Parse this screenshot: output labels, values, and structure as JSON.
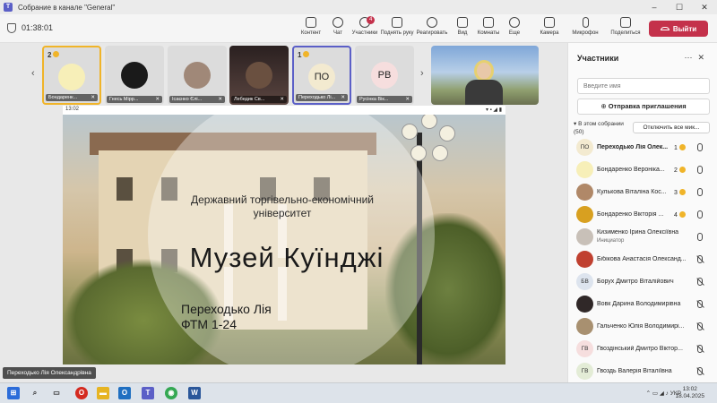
{
  "window": {
    "title": "Собрание в канале \"General\""
  },
  "toolbar": {
    "timer": "01:38:01",
    "buttons": [
      "Контент",
      "Чат",
      "Участники",
      "Поднять руку",
      "Реагировать",
      "Вид",
      "Комнаты",
      "Еще",
      "Камера",
      "Микрофон",
      "Поделиться"
    ],
    "participants_badge": "4",
    "leave_label": "Выйти"
  },
  "strip": {
    "tiles": [
      {
        "initials": "",
        "name": "Бондаренк...",
        "hand": "2"
      },
      {
        "initials": "",
        "name": "Гнесь Мірр...",
        "hand": ""
      },
      {
        "initials": "",
        "name": "Ісаєнко Єлі...",
        "hand": ""
      },
      {
        "initials": "",
        "name": "Лебедик Св...",
        "hand": ""
      },
      {
        "initials": "ПО",
        "name": "Переходько Лі...",
        "hand": "1"
      },
      {
        "initials": "РВ",
        "name": "Русінка Вік...",
        "hand": ""
      }
    ]
  },
  "slide": {
    "timestamp": "13:02",
    "university": "Державний торгівельно-економічний університет",
    "title": "Музей Куїнджі",
    "author": "Переходько Лія",
    "group": "ФТМ 1-24"
  },
  "presenter_label": "Переходько Лія Олександрівна",
  "panel": {
    "title": "Участники",
    "search_placeholder": "Введите имя",
    "invite_label": "Отправка приглашения",
    "section_label": "В этом собрании",
    "section_count": "(50)",
    "mute_all_label": "Отключить все мик...",
    "participants": [
      {
        "initials": "ПО",
        "name": "Переходько Лія Олек...",
        "hand": "1",
        "muted": false,
        "bold": true,
        "role": "",
        "color": "#f3ead0"
      },
      {
        "initials": "",
        "name": "Бондаренко Вероніка...",
        "hand": "2",
        "muted": false,
        "bold": false,
        "role": "",
        "color": "#f7efb8"
      },
      {
        "initials": "",
        "name": "Кулькова Віталіна Кос...",
        "hand": "3",
        "muted": false,
        "bold": false,
        "role": "",
        "color": "#b08868"
      },
      {
        "initials": "",
        "name": "Бондаренко Вікторія ...",
        "hand": "4",
        "muted": false,
        "bold": false,
        "role": "",
        "color": "#d8a020"
      },
      {
        "initials": "",
        "name": "Кизименко Ірина Олексіївна",
        "hand": "",
        "muted": false,
        "bold": false,
        "role": "Инициатор",
        "color": "#c8c0b8"
      },
      {
        "initials": "",
        "name": "Бібікова Анастасія Олександ...",
        "hand": "",
        "muted": true,
        "bold": false,
        "role": "",
        "color": "#c04030"
      },
      {
        "initials": "БВ",
        "name": "Борух Дмитро Віталійович",
        "hand": "",
        "muted": true,
        "bold": false,
        "role": "",
        "color": "#dde4ee"
      },
      {
        "initials": "",
        "name": "Вовк Дарина Володимирівна",
        "hand": "",
        "muted": true,
        "bold": false,
        "role": "",
        "color": "#302828"
      },
      {
        "initials": "",
        "name": "Гальченко Юлія Володимирі...",
        "hand": "",
        "muted": true,
        "bold": false,
        "role": "",
        "color": "#a89070"
      },
      {
        "initials": "ГВ",
        "name": "Гвоздінський Дмитро Віктор...",
        "hand": "",
        "muted": true,
        "bold": false,
        "role": "",
        "color": "#f6dede"
      },
      {
        "initials": "ГВ",
        "name": "Гвоздь Валерія Віталіївна",
        "hand": "",
        "muted": true,
        "bold": false,
        "role": "",
        "color": "#e3ecd6"
      }
    ]
  },
  "taskbar": {
    "lang": "УКР",
    "time": "13:02",
    "date": "18.04.2025"
  }
}
